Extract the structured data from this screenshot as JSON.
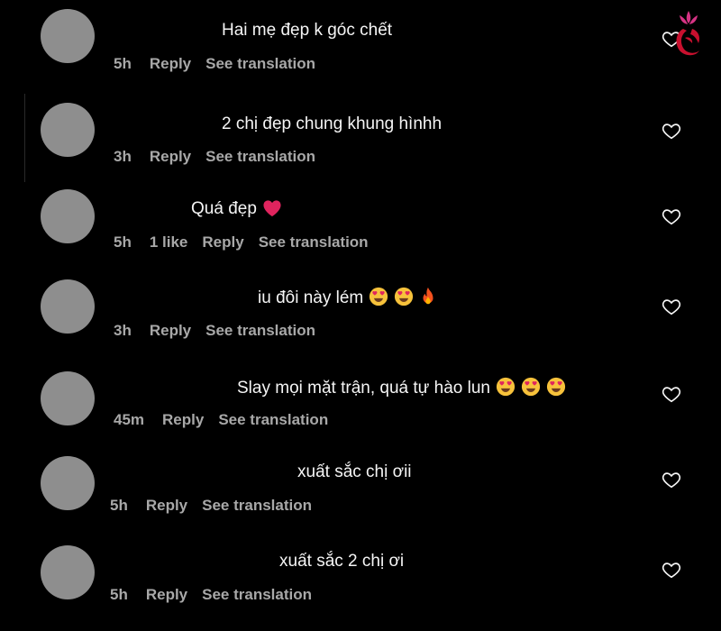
{
  "comments": [
    {
      "text": "Hai mẹ đẹp k góc chết",
      "time": "5h",
      "likes": "",
      "reply_label": "Reply",
      "translate_label": "See translation",
      "emojis": []
    },
    {
      "text": "2 chị đẹp chung khung hìnhh",
      "time": "3h",
      "likes": "",
      "reply_label": "Reply",
      "translate_label": "See translation",
      "emojis": []
    },
    {
      "text": "Quá đẹp",
      "time": "5h",
      "likes": "1 like",
      "reply_label": "Reply",
      "translate_label": "See translation",
      "emojis": [
        "red-heart"
      ]
    },
    {
      "text": "iu đôi này lém",
      "time": "3h",
      "likes": "",
      "reply_label": "Reply",
      "translate_label": "See translation",
      "emojis": [
        "heart-eyes",
        "heart-eyes",
        "fire"
      ]
    },
    {
      "text": "Slay mọi mặt trận, quá tự hào lun",
      "time": "45m",
      "likes": "",
      "reply_label": "Reply",
      "translate_label": "See translation",
      "emojis": [
        "heart-eyes",
        "heart-eyes",
        "heart-eyes"
      ]
    },
    {
      "text": "xuất sắc chị ơii",
      "time": "5h",
      "likes": "",
      "reply_label": "Reply",
      "translate_label": "See translation",
      "emojis": []
    },
    {
      "text": "xuất sắc 2 chị ơi",
      "time": "5h",
      "likes": "",
      "reply_label": "Reply",
      "translate_label": "See translation",
      "emojis": []
    }
  ],
  "icons": {
    "like": "heart-outline-icon",
    "watermark": "lotus-logo-icon"
  },
  "colors": {
    "background": "#000000",
    "text": "#f5f5f5",
    "meta": "#a8a8a8",
    "avatar": "#8e8e8e",
    "logo": "#c8102e"
  }
}
